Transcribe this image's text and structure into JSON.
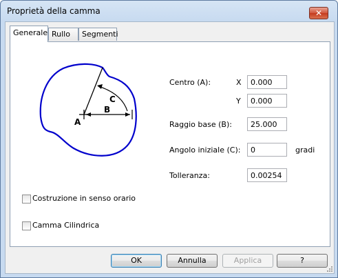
{
  "window": {
    "title": "Proprietà della camma",
    "close_glyph": "✕"
  },
  "tabs": [
    {
      "label": "Generale",
      "active": true
    },
    {
      "label": "Rullo",
      "active": false
    },
    {
      "label": "Segmenti",
      "active": false
    }
  ],
  "diagram": {
    "label_a": "A",
    "label_b": "B",
    "label_c": "C",
    "stroke_color": "#0000cc"
  },
  "fields": {
    "centro_label": "Centro (A):",
    "x_label": "X",
    "x_value": "0.000",
    "y_label": "Y",
    "y_value": "0.000",
    "raggio_label": "Raggio base (B):",
    "raggio_value": "25.000",
    "angolo_label": "Angolo iniziale (C):",
    "angolo_value": "0",
    "angolo_unit": "gradi",
    "tolleranza_label": "Tolleranza:",
    "tolleranza_value": "0.00254"
  },
  "checkboxes": {
    "orario_label": "Costruzione in senso orario",
    "orario_checked": false,
    "cilindrica_label": "Camma Cilindrica",
    "cilindrica_checked": false
  },
  "buttons": {
    "ok": "OK",
    "annulla": "Annulla",
    "applica": "Applica",
    "help": "?"
  }
}
